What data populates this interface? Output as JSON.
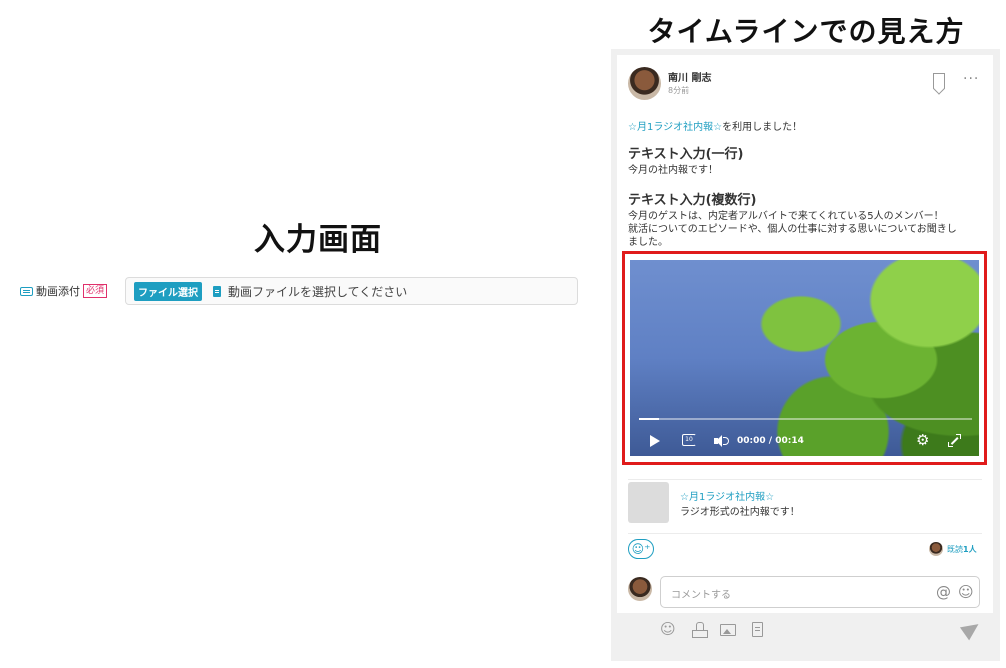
{
  "left": {
    "title": "入力画面",
    "field": {
      "label": "動画添付",
      "required": "必須",
      "button": "ファイル選択",
      "placeholder": "動画ファイルを選択してください"
    }
  },
  "right": {
    "title": "タイムラインでの見え方",
    "post": {
      "author": "南川 剛志",
      "time": "8分前",
      "more": "···",
      "app_link": "☆月1ラジオ社内報☆",
      "used_suffix": "を利用しました！",
      "section1_title": "テキスト入力(一行)",
      "section1_text": "今月の社内報です！",
      "section2_title": "テキスト入力(複数行)",
      "section2_lines": [
        "今月のゲストは、内定者アルバイトで来てくれている5人のメンバー！",
        "就活についてのエピソードや、個人の仕事に対する思いについてお聞きし",
        "ました。"
      ]
    },
    "video": {
      "current": "00:00",
      "separator": "/",
      "duration": "00:14",
      "progress": 0.06,
      "rewind_label": "10"
    },
    "app_card": {
      "name": "☆月1ラジオ社内報☆",
      "description": "ラジオ形式の社内報です！"
    },
    "reactions": {
      "add_icon": "☺⁺",
      "read_prefix": "既読",
      "read_count": "1人"
    },
    "comment": {
      "placeholder": "コメントする",
      "at": "@",
      "smile": "☺"
    },
    "toolbar": {
      "emoji": "☺"
    }
  },
  "colors": {
    "accent": "#1e9ec1",
    "required": "#e0306b",
    "highlight_border": "#e01b1b"
  }
}
